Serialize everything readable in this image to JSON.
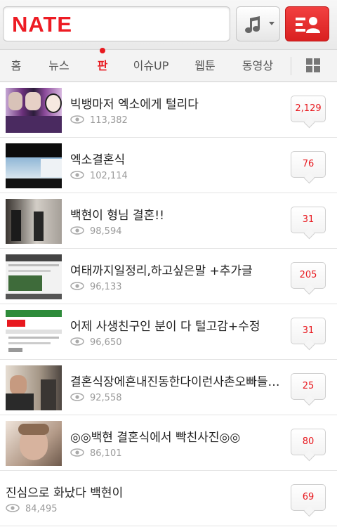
{
  "header": {
    "logo_text": "NATE",
    "search_placeholder": ""
  },
  "nav": {
    "tabs": [
      {
        "label": "홈"
      },
      {
        "label": "뉴스"
      },
      {
        "label": "판"
      },
      {
        "label": "이슈UP"
      },
      {
        "label": "웹툰"
      },
      {
        "label": "동영상"
      }
    ],
    "active_tab": "판"
  },
  "colors": {
    "brand": "#ed1c24",
    "comment_count": "#e8191f"
  },
  "posts": [
    {
      "title": "빅뱅마저 엑소에게 털리다",
      "views": "113,382",
      "comments": "2,129"
    },
    {
      "title": "엑소결혼식",
      "views": "102,114",
      "comments": "76"
    },
    {
      "title": "백현이 형님 결혼!!",
      "views": "98,594",
      "comments": "31"
    },
    {
      "title": "여태까지일정리,하고싶은말 +추가글",
      "views": "96,133",
      "comments": "205"
    },
    {
      "title": "어제 사생친구인 분이 다 털고감+수정",
      "views": "96,650",
      "comments": "31"
    },
    {
      "title": "결혼식장에흔내진동한다이런사촌오빠들있...",
      "views": "92,558",
      "comments": "25"
    },
    {
      "title": "◎◎백현 결혼식에서 빡친사진◎◎",
      "views": "86,101",
      "comments": "80"
    },
    {
      "title": "진심으로 화났다 백현이",
      "views": "84,495",
      "comments": "69"
    }
  ]
}
